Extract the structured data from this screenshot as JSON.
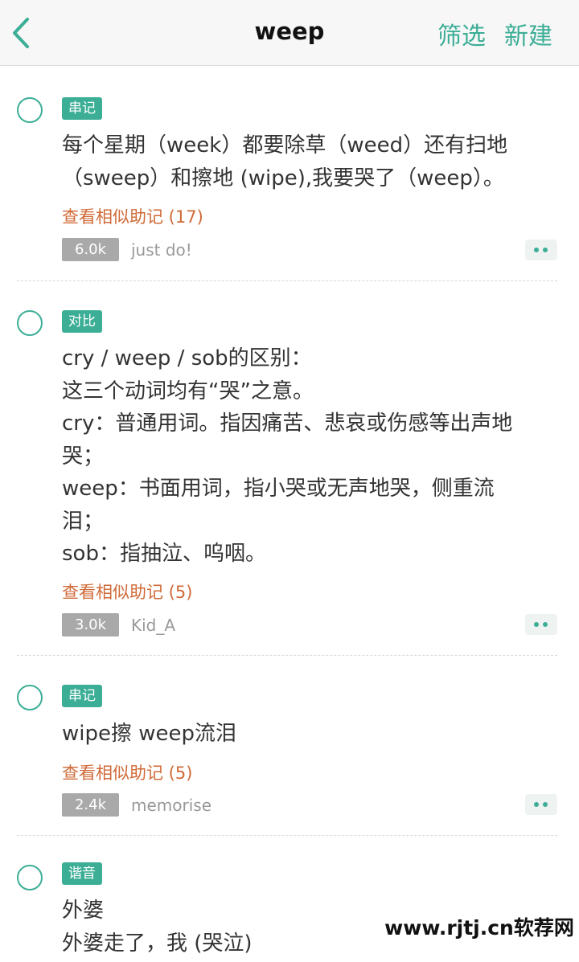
{
  "nav": {
    "title": "weep",
    "filter_label": "筛选",
    "new_label": "新建",
    "accent_color": "#3cae96"
  },
  "entries": [
    {
      "tag": "串记",
      "lines": [
        "每个星期（week）都要除草（weed）还有扫地",
        "（sweep）和擦地 (wipe),我要哭了（weep）。"
      ],
      "similar": "查看相似助记 (17)",
      "count": "6.0k",
      "author": "just do!"
    },
    {
      "tag": "对比",
      "lines": [
        "cry / weep / sob的区别：",
        "这三个动词均有“哭”之意。",
        "cry：普通用词。指因痛苦、悲哀或伤感等出声地",
        "哭；",
        "weep：书面用词，指小哭或无声地哭，侧重流",
        "泪；",
        "sob：指抽泣、呜咽。"
      ],
      "similar": "查看相似助记 (5)",
      "count": "3.0k",
      "author": "Kid_A"
    },
    {
      "tag": "串记",
      "lines": [
        "wipe擦 weep流泪"
      ],
      "similar": "查看相似助记 (5)",
      "count": "2.4k",
      "author": "memorise"
    },
    {
      "tag": "谐音",
      "lines": [
        "外婆",
        "外婆走了，我 (哭泣)"
      ]
    }
  ],
  "watermark": "www.rjtj.cn软荐网"
}
